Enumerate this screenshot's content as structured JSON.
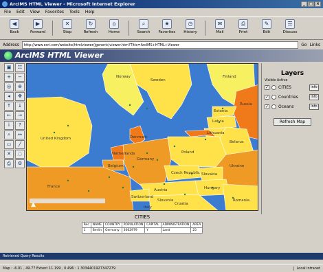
{
  "window": {
    "title": "ArcIMS HTML Viewer - Microsoft Internet Explorer",
    "min": "_",
    "max": "□",
    "close": "×"
  },
  "menu": [
    "File",
    "Edit",
    "View",
    "Favorites",
    "Tools",
    "Help"
  ],
  "toolbar": [
    {
      "label": "Back",
      "icon": "◀"
    },
    {
      "label": "Forward",
      "icon": "▶"
    },
    {
      "label": "Stop",
      "icon": "✕"
    },
    {
      "label": "Refresh",
      "icon": "↻"
    },
    {
      "label": "Home",
      "icon": "⌂"
    },
    {
      "label": "Search",
      "icon": "⌕"
    },
    {
      "label": "Favorites",
      "icon": "★"
    },
    {
      "label": "History",
      "icon": "◷"
    },
    {
      "label": "Mail",
      "icon": "✉"
    },
    {
      "label": "Print",
      "icon": "⎙"
    },
    {
      "label": "Edit",
      "icon": "✎"
    },
    {
      "label": "Discuss",
      "icon": "☰"
    }
  ],
  "address": {
    "label": "Address",
    "value": "http://www.esri.com/website/htmlviewer/jgeneric/viewer.htm?Title=ArcIMS+HTML+Viewer",
    "go": "Go",
    "links": "Links"
  },
  "viewer": {
    "title": "ArcIMS HTML Viewer"
  },
  "map": {
    "labels": [
      "Norway",
      "Sweden",
      "Finland",
      "Estonia",
      "Latvia",
      "Lithuania",
      "Russia",
      "Belarus",
      "Denmark",
      "United Kingdom",
      "Netherlands",
      "Belgium",
      "Germany",
      "Poland",
      "Ukraine",
      "France",
      "Czech Republic",
      "Slovakia",
      "Austria",
      "Hungary",
      "Romania",
      "Switzerland",
      "Slovenia",
      "Croatia",
      "Italy"
    ]
  },
  "layers": {
    "title": "Layers",
    "visible_note": "Visible Active",
    "items": [
      {
        "name": "CITIES",
        "button": "info"
      },
      {
        "name": "Countries",
        "button": "info"
      },
      {
        "name": "Oceans",
        "button": "info"
      }
    ],
    "refresh": "Refresh Map"
  },
  "results": {
    "title": "CITIES",
    "headers": [
      "Rec",
      "NAME",
      "COUNTRY",
      "POPULATION",
      "CAPITAL",
      "ADMINISTRATION",
      "AREA"
    ],
    "rows": [
      [
        "1",
        "Berlin",
        "Germany",
        "3062979",
        "Y",
        "Land",
        "25"
      ]
    ]
  },
  "status_message": "Retrieved Query Results",
  "iestatus": {
    "text": "Map : -6.01 , 49.77  Extent 11.199 , 0.496 : 1.3034401927347279",
    "zone": "Local intranet"
  }
}
